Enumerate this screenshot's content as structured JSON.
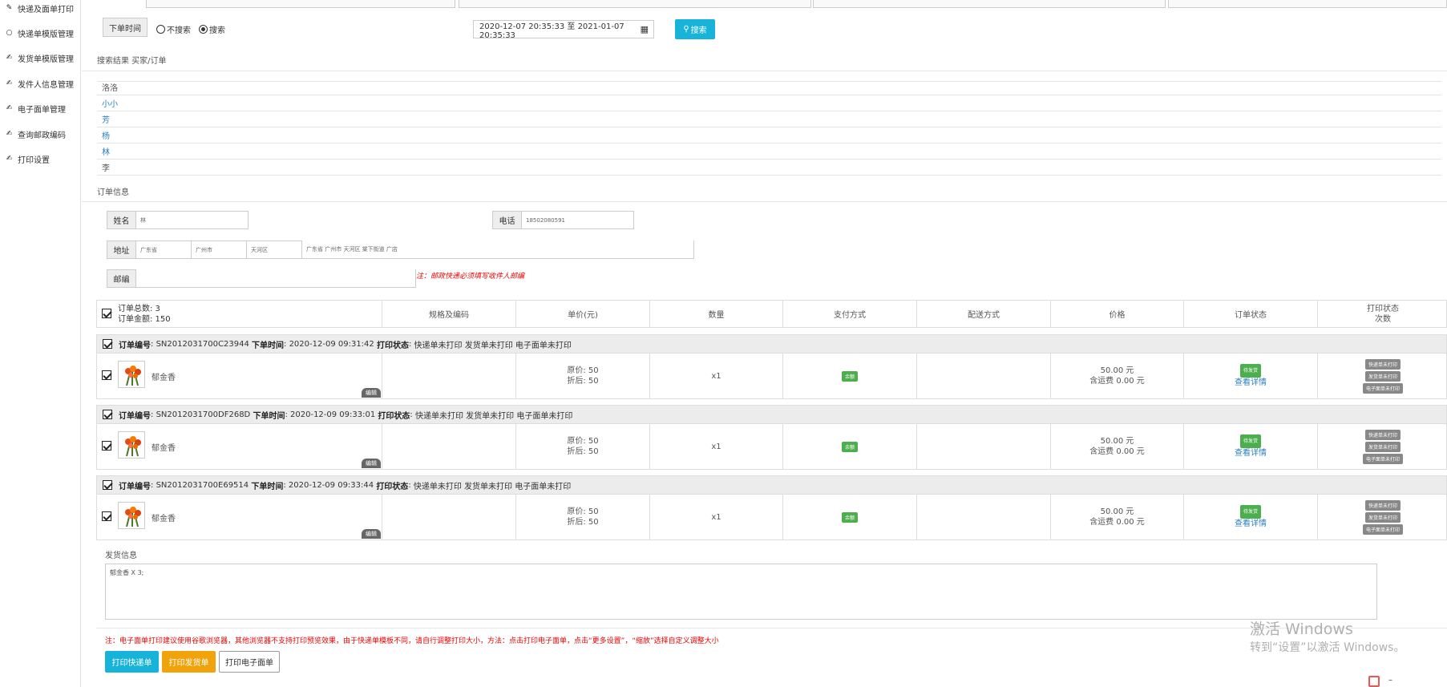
{
  "sidebar": {
    "items": [
      {
        "label": "快递及面单打印",
        "icon": "pencil-icon"
      },
      {
        "label": "快递单模版管理",
        "icon": "circle-icon"
      },
      {
        "label": "发货单模版管理",
        "icon": "edit-icon"
      },
      {
        "label": "发件人信息管理",
        "icon": "edit-icon"
      },
      {
        "label": "电子面单管理",
        "icon": "edit-icon"
      },
      {
        "label": "查询邮政编码",
        "icon": "edit-icon"
      },
      {
        "label": "打印设置",
        "icon": "edit-icon"
      }
    ]
  },
  "filter": {
    "time_label": "下单时间",
    "radio_no_search": "不搜索",
    "radio_search": "搜索",
    "date_range": "2020-12-07 20:35:33 至 2021-01-07 20:35:33",
    "search_button": "搜索"
  },
  "results": {
    "title": "搜索结果 买家/订单",
    "buyers": [
      "洛洛",
      "小小",
      "芳",
      "杨",
      "林",
      "李"
    ]
  },
  "order_info": {
    "title": "订单信息",
    "name_label": "姓名",
    "name_value": "林",
    "phone_label": "电话",
    "phone_value": "18502080591",
    "address_label": "地址",
    "province": "广东省",
    "city": "广州市",
    "district": "天河区",
    "address_detail": "广东省 广州市 天河区 棠下街道 广店",
    "zip_label": "邮编",
    "zip_value": "",
    "zip_note": "注：邮政快递必须填写收件人邮编"
  },
  "table": {
    "total_count": "订单总数: 3",
    "total_amount": "订单金额: 150",
    "columns": [
      "规格及编码",
      "单价(元)",
      "数量",
      "支付方式",
      "配送方式",
      "价格",
      "订单状态",
      "打印状态"
    ],
    "print_sub": "次数"
  },
  "orders": [
    {
      "order_no_label": "订单编号",
      "order_no": "SN2012031700C23944",
      "time_label": "下单时间",
      "time": "2020-12-09 09:31:42",
      "print_label": "打印状态",
      "print_status": "快递单未打印 发货单未打印 电子面单未打印",
      "product": "郁金香",
      "edit": "编辑",
      "orig_price": "原价: 50",
      "disc_price": "折后: 50",
      "qty": "x1",
      "payment": "余额",
      "price": "50.00 元",
      "shipping": "含运费 0.00 元",
      "status_tag": "待发货",
      "status_link": "查看详情",
      "print_tags": [
        "快递单未打印",
        "发货单未打印",
        "电子面单未打印"
      ]
    },
    {
      "order_no_label": "订单编号",
      "order_no": "SN2012031700DF268D",
      "time_label": "下单时间",
      "time": "2020-12-09 09:33:01",
      "print_label": "打印状态",
      "print_status": "快递单未打印 发货单未打印 电子面单未打印",
      "product": "郁金香",
      "edit": "编辑",
      "orig_price": "原价: 50",
      "disc_price": "折后: 50",
      "qty": "x1",
      "payment": "余额",
      "price": "50.00 元",
      "shipping": "含运费 0.00 元",
      "status_tag": "待发货",
      "status_link": "查看详情",
      "print_tags": [
        "快递单未打印",
        "发货单未打印",
        "电子面单未打印"
      ]
    },
    {
      "order_no_label": "订单编号",
      "order_no": "SN2012031700E69514",
      "time_label": "下单时间",
      "time": "2020-12-09 09:33:44",
      "print_label": "打印状态",
      "print_status": "快递单未打印 发货单未打印 电子面单未打印",
      "product": "郁金香",
      "edit": "编辑",
      "orig_price": "原价: 50",
      "disc_price": "折后: 50",
      "qty": "x1",
      "payment": "余额",
      "price": "50.00 元",
      "shipping": "含运费 0.00 元",
      "status_tag": "待发货",
      "status_link": "查看详情",
      "print_tags": [
        "快递单未打印",
        "发货单未打印",
        "电子面单未打印"
      ]
    }
  ],
  "shipping_info": {
    "title": "发货信息",
    "content": "郁金香 X 3;"
  },
  "bottom_note": "注：电子面单打印建议使用谷歌浏览器，其他浏览器不支持打印预览效果，由于快递单模板不同，请自行调整打印大小，方法：点击打印电子面单，点击“更多设置”，“缩放”选择自定义调整大小",
  "buttons": {
    "print_express": "打印快递单",
    "print_delivery": "打印发货单",
    "print_eorder": "打印电子面单"
  },
  "watermark": {
    "line1": "激活 Windows",
    "line2": "转到“设置”以激活 Windows。"
  },
  "colors": {
    "accent": "#17b3d9",
    "orange": "#f0a30a",
    "green": "#4cae4c",
    "red": "#e00000"
  }
}
